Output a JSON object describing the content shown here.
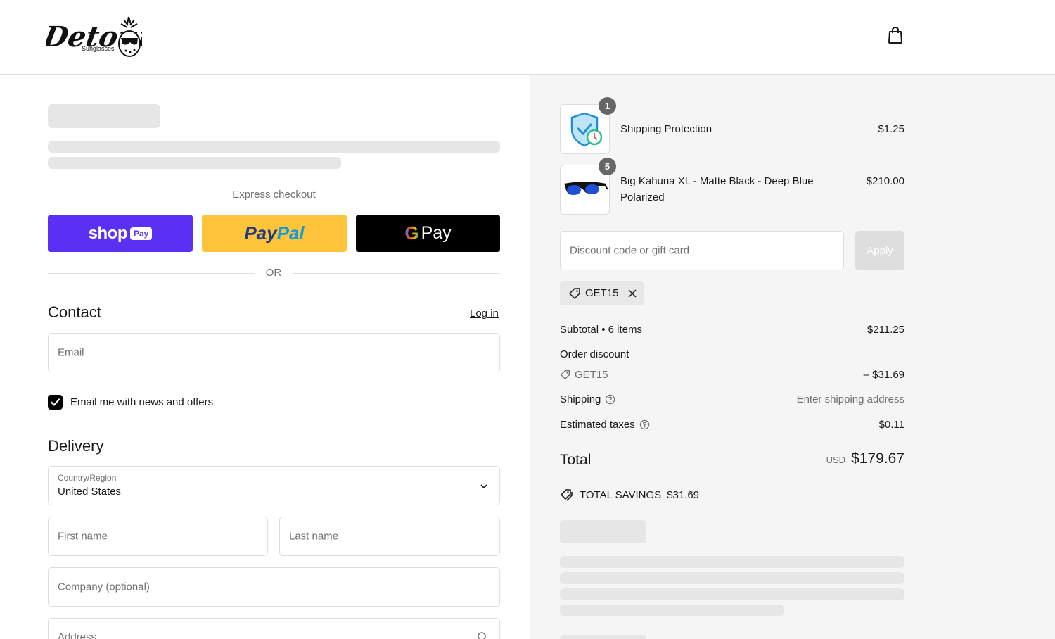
{
  "header": {
    "logo_text": "Detour",
    "logo_subtext": "Sunglasses",
    "cart_icon": "shopping-bag-icon"
  },
  "express": {
    "label": "Express checkout",
    "shop_pay": {
      "word": "shop",
      "badge": "Pay"
    },
    "paypal": {
      "part1": "Pay",
      "part2": "Pal"
    },
    "gpay": {
      "g": "G",
      "word": "Pay"
    },
    "or": "OR"
  },
  "contact": {
    "heading": "Contact",
    "login_link": "Log in",
    "email_placeholder": "Email",
    "newsletter_label": "Email me with news and offers",
    "newsletter_checked": true
  },
  "delivery": {
    "heading": "Delivery",
    "country_label": "Country/Region",
    "country_value": "United States",
    "first_name_placeholder": "First name",
    "last_name_placeholder": "Last name",
    "company_placeholder": "Company (optional)",
    "address_placeholder": "Address"
  },
  "cart": {
    "items": [
      {
        "name": "Shipping Protection",
        "price": "$1.25",
        "qty": "1",
        "icon": "shield-clock-icon"
      },
      {
        "name": "Big Kahuna XL - Matte Black - Deep Blue Polarized",
        "price": "$210.00",
        "qty": "5",
        "icon": "sunglasses-icon"
      }
    ]
  },
  "discount": {
    "placeholder": "Discount code or gift card",
    "apply_label": "Apply",
    "applied_code": "GET15"
  },
  "summary": {
    "subtotal_label": "Subtotal • 6 items",
    "subtotal_value": "$211.25",
    "order_discount_label": "Order discount",
    "discount_code": "GET15",
    "discount_value": "– $31.69",
    "shipping_label": "Shipping",
    "shipping_value": "Enter shipping address",
    "taxes_label": "Estimated taxes",
    "taxes_value": "$0.11",
    "total_label": "Total",
    "total_currency": "USD",
    "total_value": "$179.67",
    "savings_label": "TOTAL SAVINGS",
    "savings_value": "$31.69"
  },
  "colors": {
    "shop_pay": "#5a31f4",
    "paypal": "#ffc439",
    "gpay": "#000000",
    "skeleton": "#e6e6e6",
    "summary_bg": "#f5f5f5"
  }
}
